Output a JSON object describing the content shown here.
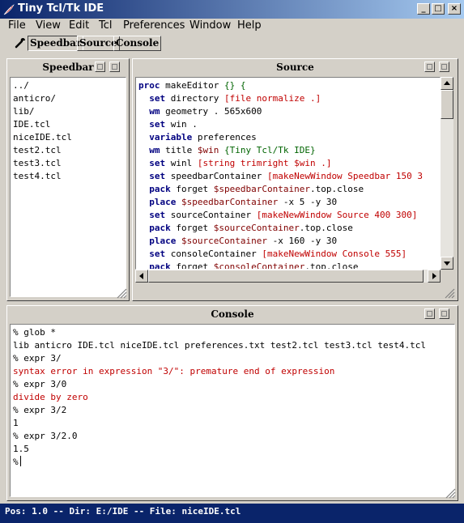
{
  "window": {
    "title": "Tiny Tcl/Tk IDE",
    "controls": {
      "minimize": "_",
      "maximize": "□",
      "close": "×"
    }
  },
  "menubar": {
    "items": [
      "File",
      "View",
      "Edit",
      "Tcl",
      "Preferences",
      "Window",
      "Help"
    ]
  },
  "toolbar": {
    "icon": "wrench-icon",
    "buttons": [
      "Speedbar",
      "Source",
      "Console"
    ]
  },
  "speedbar": {
    "title": "Speedbar",
    "files": [
      "../",
      "anticro/",
      "lib/",
      "IDE.tcl",
      "niceIDE.tcl",
      "test2.tcl",
      "test3.tcl",
      "test4.tcl"
    ]
  },
  "source": {
    "title": "Source",
    "lines": [
      [
        {
          "t": "proc",
          "c": "kw"
        },
        {
          "t": " makeEditor ",
          "c": "plain"
        },
        {
          "t": "{}",
          "c": "brace"
        },
        {
          "t": " ",
          "c": "plain"
        },
        {
          "t": "{",
          "c": "brace"
        }
      ],
      [
        {
          "t": "  ",
          "c": "plain"
        },
        {
          "t": "set",
          "c": "kw"
        },
        {
          "t": " directory ",
          "c": "plain"
        },
        {
          "t": "[file normalize .]",
          "c": "str"
        }
      ],
      [
        {
          "t": "  ",
          "c": "plain"
        },
        {
          "t": "wm",
          "c": "kw"
        },
        {
          "t": " geometry . 565x600",
          "c": "plain"
        }
      ],
      [
        {
          "t": "  ",
          "c": "plain"
        },
        {
          "t": "set",
          "c": "kw"
        },
        {
          "t": " win .",
          "c": "plain"
        }
      ],
      [
        {
          "t": "  ",
          "c": "plain"
        },
        {
          "t": "variable",
          "c": "kw"
        },
        {
          "t": " preferences",
          "c": "plain"
        }
      ],
      [
        {
          "t": "  ",
          "c": "plain"
        },
        {
          "t": "wm",
          "c": "kw"
        },
        {
          "t": " title ",
          "c": "plain"
        },
        {
          "t": "$win",
          "c": "var"
        },
        {
          "t": " ",
          "c": "plain"
        },
        {
          "t": "{Tiny Tcl/Tk IDE}",
          "c": "brace"
        }
      ],
      [
        {
          "t": "  ",
          "c": "plain"
        },
        {
          "t": "set",
          "c": "kw"
        },
        {
          "t": " winl ",
          "c": "plain"
        },
        {
          "t": "[string trimright $win .]",
          "c": "str"
        }
      ],
      [
        {
          "t": "  ",
          "c": "plain"
        },
        {
          "t": "set",
          "c": "kw"
        },
        {
          "t": " speedbarContainer ",
          "c": "plain"
        },
        {
          "t": "[makeNewWindow Speedbar 150 3",
          "c": "str"
        }
      ],
      [
        {
          "t": "  ",
          "c": "plain"
        },
        {
          "t": "pack",
          "c": "kw"
        },
        {
          "t": " forget ",
          "c": "plain"
        },
        {
          "t": "$speedbarContainer",
          "c": "var"
        },
        {
          "t": ".top.close",
          "c": "plain"
        }
      ],
      [
        {
          "t": "  ",
          "c": "plain"
        },
        {
          "t": "place",
          "c": "kw"
        },
        {
          "t": " ",
          "c": "plain"
        },
        {
          "t": "$speedbarContainer",
          "c": "var"
        },
        {
          "t": " -x 5 -y 30",
          "c": "plain"
        }
      ],
      [
        {
          "t": "  ",
          "c": "plain"
        },
        {
          "t": "set",
          "c": "kw"
        },
        {
          "t": " sourceContainer ",
          "c": "plain"
        },
        {
          "t": "[makeNewWindow Source 400 300]",
          "c": "str"
        }
      ],
      [
        {
          "t": "  ",
          "c": "plain"
        },
        {
          "t": "pack",
          "c": "kw"
        },
        {
          "t": " forget ",
          "c": "plain"
        },
        {
          "t": "$sourceContainer",
          "c": "var"
        },
        {
          "t": ".top.close",
          "c": "plain"
        }
      ],
      [
        {
          "t": "  ",
          "c": "plain"
        },
        {
          "t": "place",
          "c": "kw"
        },
        {
          "t": " ",
          "c": "plain"
        },
        {
          "t": "$sourceContainer",
          "c": "var"
        },
        {
          "t": " -x 160 -y 30",
          "c": "plain"
        }
      ],
      [
        {
          "t": "  ",
          "c": "plain"
        },
        {
          "t": "set",
          "c": "kw"
        },
        {
          "t": " consoleContainer ",
          "c": "plain"
        },
        {
          "t": "[makeNewWindow Console 555]",
          "c": "str"
        }
      ],
      [
        {
          "t": "  ",
          "c": "plain"
        },
        {
          "t": "pack",
          "c": "kw"
        },
        {
          "t": " forget ",
          "c": "plain"
        },
        {
          "t": "$consoleContainer",
          "c": "var"
        },
        {
          "t": ".top.close",
          "c": "plain"
        }
      ]
    ]
  },
  "console": {
    "title": "Console",
    "lines": [
      {
        "t": "% glob *",
        "c": "plain"
      },
      {
        "t": "lib anticro IDE.tcl niceIDE.tcl preferences.txt test2.tcl test3.tcl test4.tcl",
        "c": "plain"
      },
      {
        "t": "% expr 3/",
        "c": "plain"
      },
      {
        "t": "syntax error in expression \"3/\": premature end of expression",
        "c": "err"
      },
      {
        "t": "% expr 3/0",
        "c": "plain"
      },
      {
        "t": "divide by zero",
        "c": "err"
      },
      {
        "t": "% expr 3/2",
        "c": "plain"
      },
      {
        "t": "1",
        "c": "plain"
      },
      {
        "t": "% expr 3/2.0",
        "c": "plain"
      },
      {
        "t": "1.5",
        "c": "plain"
      }
    ],
    "prompt": "%"
  },
  "statusbar": {
    "text": "Pos: 1.0 -- Dir: E:/IDE -- File: niceIDE.tcl"
  },
  "colors": {
    "title_bar": "#0a246a",
    "keyword": "#000080",
    "string": "#c00000",
    "variable": "#800000",
    "brace": "#006400"
  }
}
